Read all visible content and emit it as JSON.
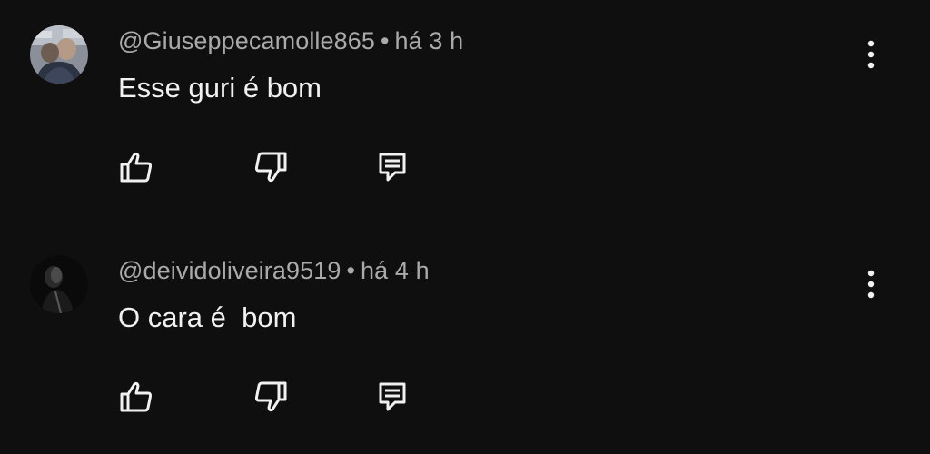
{
  "comments": [
    {
      "username": "@Giuseppecamolle865",
      "separator": "•",
      "time": "há 3 h",
      "text": "Esse guri é bom",
      "avatar_icon": "user-photo-avatar"
    },
    {
      "username": "@deividoliveira9519",
      "separator": "•",
      "time": "há 4 h",
      "text": "O cara é  bom",
      "avatar_icon": "user-photo-avatar-dark"
    }
  ],
  "icons": {
    "like": "thumbs-up-icon",
    "dislike": "thumbs-down-icon",
    "reply": "reply-comment-icon",
    "more": "more-vertical-icon"
  },
  "colors": {
    "background": "#0f0f0f",
    "meta": "#aaaaaa",
    "text": "#f1f1f1"
  }
}
